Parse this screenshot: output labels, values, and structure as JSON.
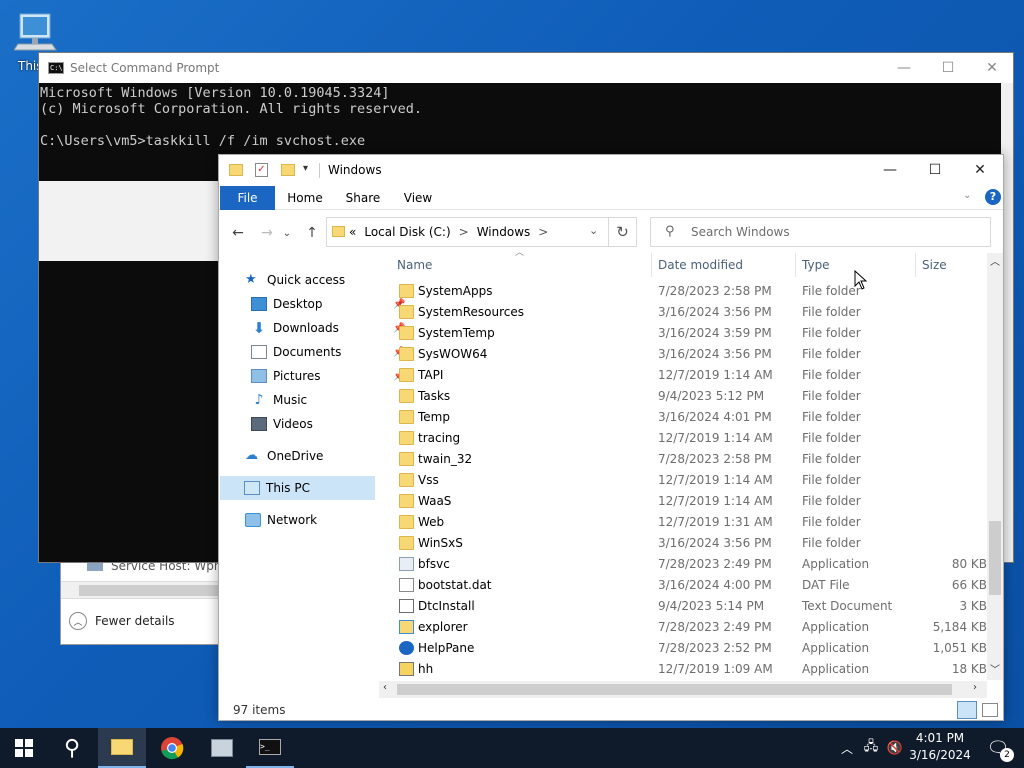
{
  "desktop": {
    "icon_label": "This"
  },
  "taskmgr": {
    "process": "Service Host: Wpho",
    "fewer_details": "Fewer details"
  },
  "cmd": {
    "title": "Select Command Prompt",
    "lines": [
      "Microsoft Windows [Version 10.0.19045.3324]",
      "(c) Microsoft Corporation. All rights reserved.",
      "",
      "C:\\Users\\vm5>taskkill /f /im svchost.exe"
    ]
  },
  "explorer": {
    "title": "Windows",
    "tabs": {
      "file": "File",
      "home": "Home",
      "share": "Share",
      "view": "View"
    },
    "address": {
      "prefix": "«",
      "crumb1": "Local Disk (C:)",
      "sep1": ">",
      "crumb2": "Windows",
      "sep2": ">"
    },
    "search_placeholder": "Search Windows",
    "nav": {
      "quick_access": "Quick access",
      "desktop": "Desktop",
      "downloads": "Downloads",
      "documents": "Documents",
      "pictures": "Pictures",
      "music": "Music",
      "videos": "Videos",
      "onedrive": "OneDrive",
      "this_pc": "This PC",
      "network": "Network"
    },
    "columns": {
      "name": "Name",
      "date": "Date modified",
      "type": "Type",
      "size": "Size"
    },
    "files": [
      {
        "name": "SystemApps",
        "date": "7/28/2023 2:58 PM",
        "type": "File folder",
        "size": "",
        "icon": "folder"
      },
      {
        "name": "SystemResources",
        "date": "3/16/2024 3:56 PM",
        "type": "File folder",
        "size": "",
        "icon": "folder"
      },
      {
        "name": "SystemTemp",
        "date": "3/16/2024 3:59 PM",
        "type": "File folder",
        "size": "",
        "icon": "folder"
      },
      {
        "name": "SysWOW64",
        "date": "3/16/2024 3:56 PM",
        "type": "File folder",
        "size": "",
        "icon": "folder"
      },
      {
        "name": "TAPI",
        "date": "12/7/2019 1:14 AM",
        "type": "File folder",
        "size": "",
        "icon": "folder"
      },
      {
        "name": "Tasks",
        "date": "9/4/2023 5:12 PM",
        "type": "File folder",
        "size": "",
        "icon": "folder"
      },
      {
        "name": "Temp",
        "date": "3/16/2024 4:01 PM",
        "type": "File folder",
        "size": "",
        "icon": "folder"
      },
      {
        "name": "tracing",
        "date": "12/7/2019 1:14 AM",
        "type": "File folder",
        "size": "",
        "icon": "folder"
      },
      {
        "name": "twain_32",
        "date": "7/28/2023 2:58 PM",
        "type": "File folder",
        "size": "",
        "icon": "folder"
      },
      {
        "name": "Vss",
        "date": "12/7/2019 1:14 AM",
        "type": "File folder",
        "size": "",
        "icon": "folder"
      },
      {
        "name": "WaaS",
        "date": "12/7/2019 1:14 AM",
        "type": "File folder",
        "size": "",
        "icon": "folder"
      },
      {
        "name": "Web",
        "date": "12/7/2019 1:31 AM",
        "type": "File folder",
        "size": "",
        "icon": "folder"
      },
      {
        "name": "WinSxS",
        "date": "3/16/2024 3:56 PM",
        "type": "File folder",
        "size": "",
        "icon": "folder"
      },
      {
        "name": "bfsvc",
        "date": "7/28/2023 2:49 PM",
        "type": "Application",
        "size": "80 KB",
        "icon": "app"
      },
      {
        "name": "bootstat.dat",
        "date": "3/16/2024 4:00 PM",
        "type": "DAT File",
        "size": "66 KB",
        "icon": "file"
      },
      {
        "name": "DtcInstall",
        "date": "9/4/2023 5:14 PM",
        "type": "Text Document",
        "size": "3 KB",
        "icon": "text"
      },
      {
        "name": "explorer",
        "date": "7/28/2023 2:49 PM",
        "type": "Application",
        "size": "5,184 KB",
        "icon": "explorer"
      },
      {
        "name": "HelpPane",
        "date": "7/28/2023 2:52 PM",
        "type": "Application",
        "size": "1,051 KB",
        "icon": "help"
      },
      {
        "name": "hh",
        "date": "12/7/2019 1:09 AM",
        "type": "Application",
        "size": "18 KB",
        "icon": "hh"
      }
    ],
    "status_items": "97 items"
  },
  "taskbar": {
    "time": "4:01 PM",
    "date": "3/16/2024",
    "notif_count": "2"
  }
}
